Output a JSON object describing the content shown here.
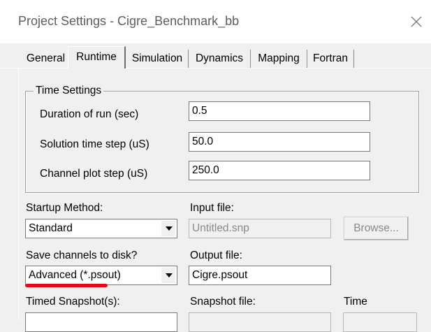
{
  "window": {
    "title": "Project Settings - Cigre_Benchmark_bb",
    "close_icon": "close-icon"
  },
  "tabs": [
    {
      "label": "General",
      "active": false
    },
    {
      "label": "Runtime",
      "active": true
    },
    {
      "label": "Simulation",
      "active": false
    },
    {
      "label": "Dynamics",
      "active": false
    },
    {
      "label": "Mapping",
      "active": false
    },
    {
      "label": "Fortran",
      "active": false
    }
  ],
  "time_settings": {
    "legend": "Time Settings",
    "duration": {
      "label": "Duration of run (sec)",
      "value": "0.5"
    },
    "solution_step": {
      "label": "Solution time step (uS)",
      "value": "50.0"
    },
    "channel_step": {
      "label": "Channel plot step (uS)",
      "value": "250.0"
    }
  },
  "startup": {
    "label": "Startup Method:",
    "selected": "Standard"
  },
  "input_file": {
    "label": "Input file:",
    "value": "Untitled.snp",
    "browse_label": "Browse..."
  },
  "save_channels": {
    "label": "Save channels to disk?",
    "selected": "Advanced (*.psout)",
    "highlight_color": "#e10b1a"
  },
  "output_file": {
    "label": "Output file:",
    "value": "Cigre.psout"
  },
  "timed_snapshot": {
    "label": "Timed Snapshot(s):"
  },
  "snapshot_file": {
    "label": "Snapshot file:"
  },
  "time": {
    "label": "Time"
  },
  "colors": {
    "window_bg": "#f0f0f0",
    "title_bg": "#ffffff",
    "title_text": "#5e5e5e",
    "disabled_text": "#8a8a8a"
  }
}
